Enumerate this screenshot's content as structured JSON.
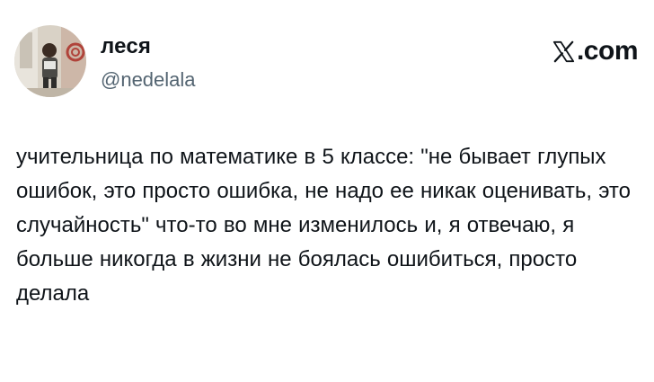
{
  "author": {
    "display_name": "леся",
    "handle": "@nedelala"
  },
  "brand": {
    "label": ".com",
    "icon": "x-logo-icon"
  },
  "tweet": {
    "text": "учительница по математике в 5 классе: \"не бывает глупых ошибок, это просто ошибка, не надо ее никак оценивать, это случайность\" что-то во мне изменилось и, я отвечаю, я больше никогда в жизни не боялась ошибиться, просто делала"
  },
  "colors": {
    "text": "#0f1419",
    "secondary": "#536471",
    "background": "#ffffff"
  }
}
